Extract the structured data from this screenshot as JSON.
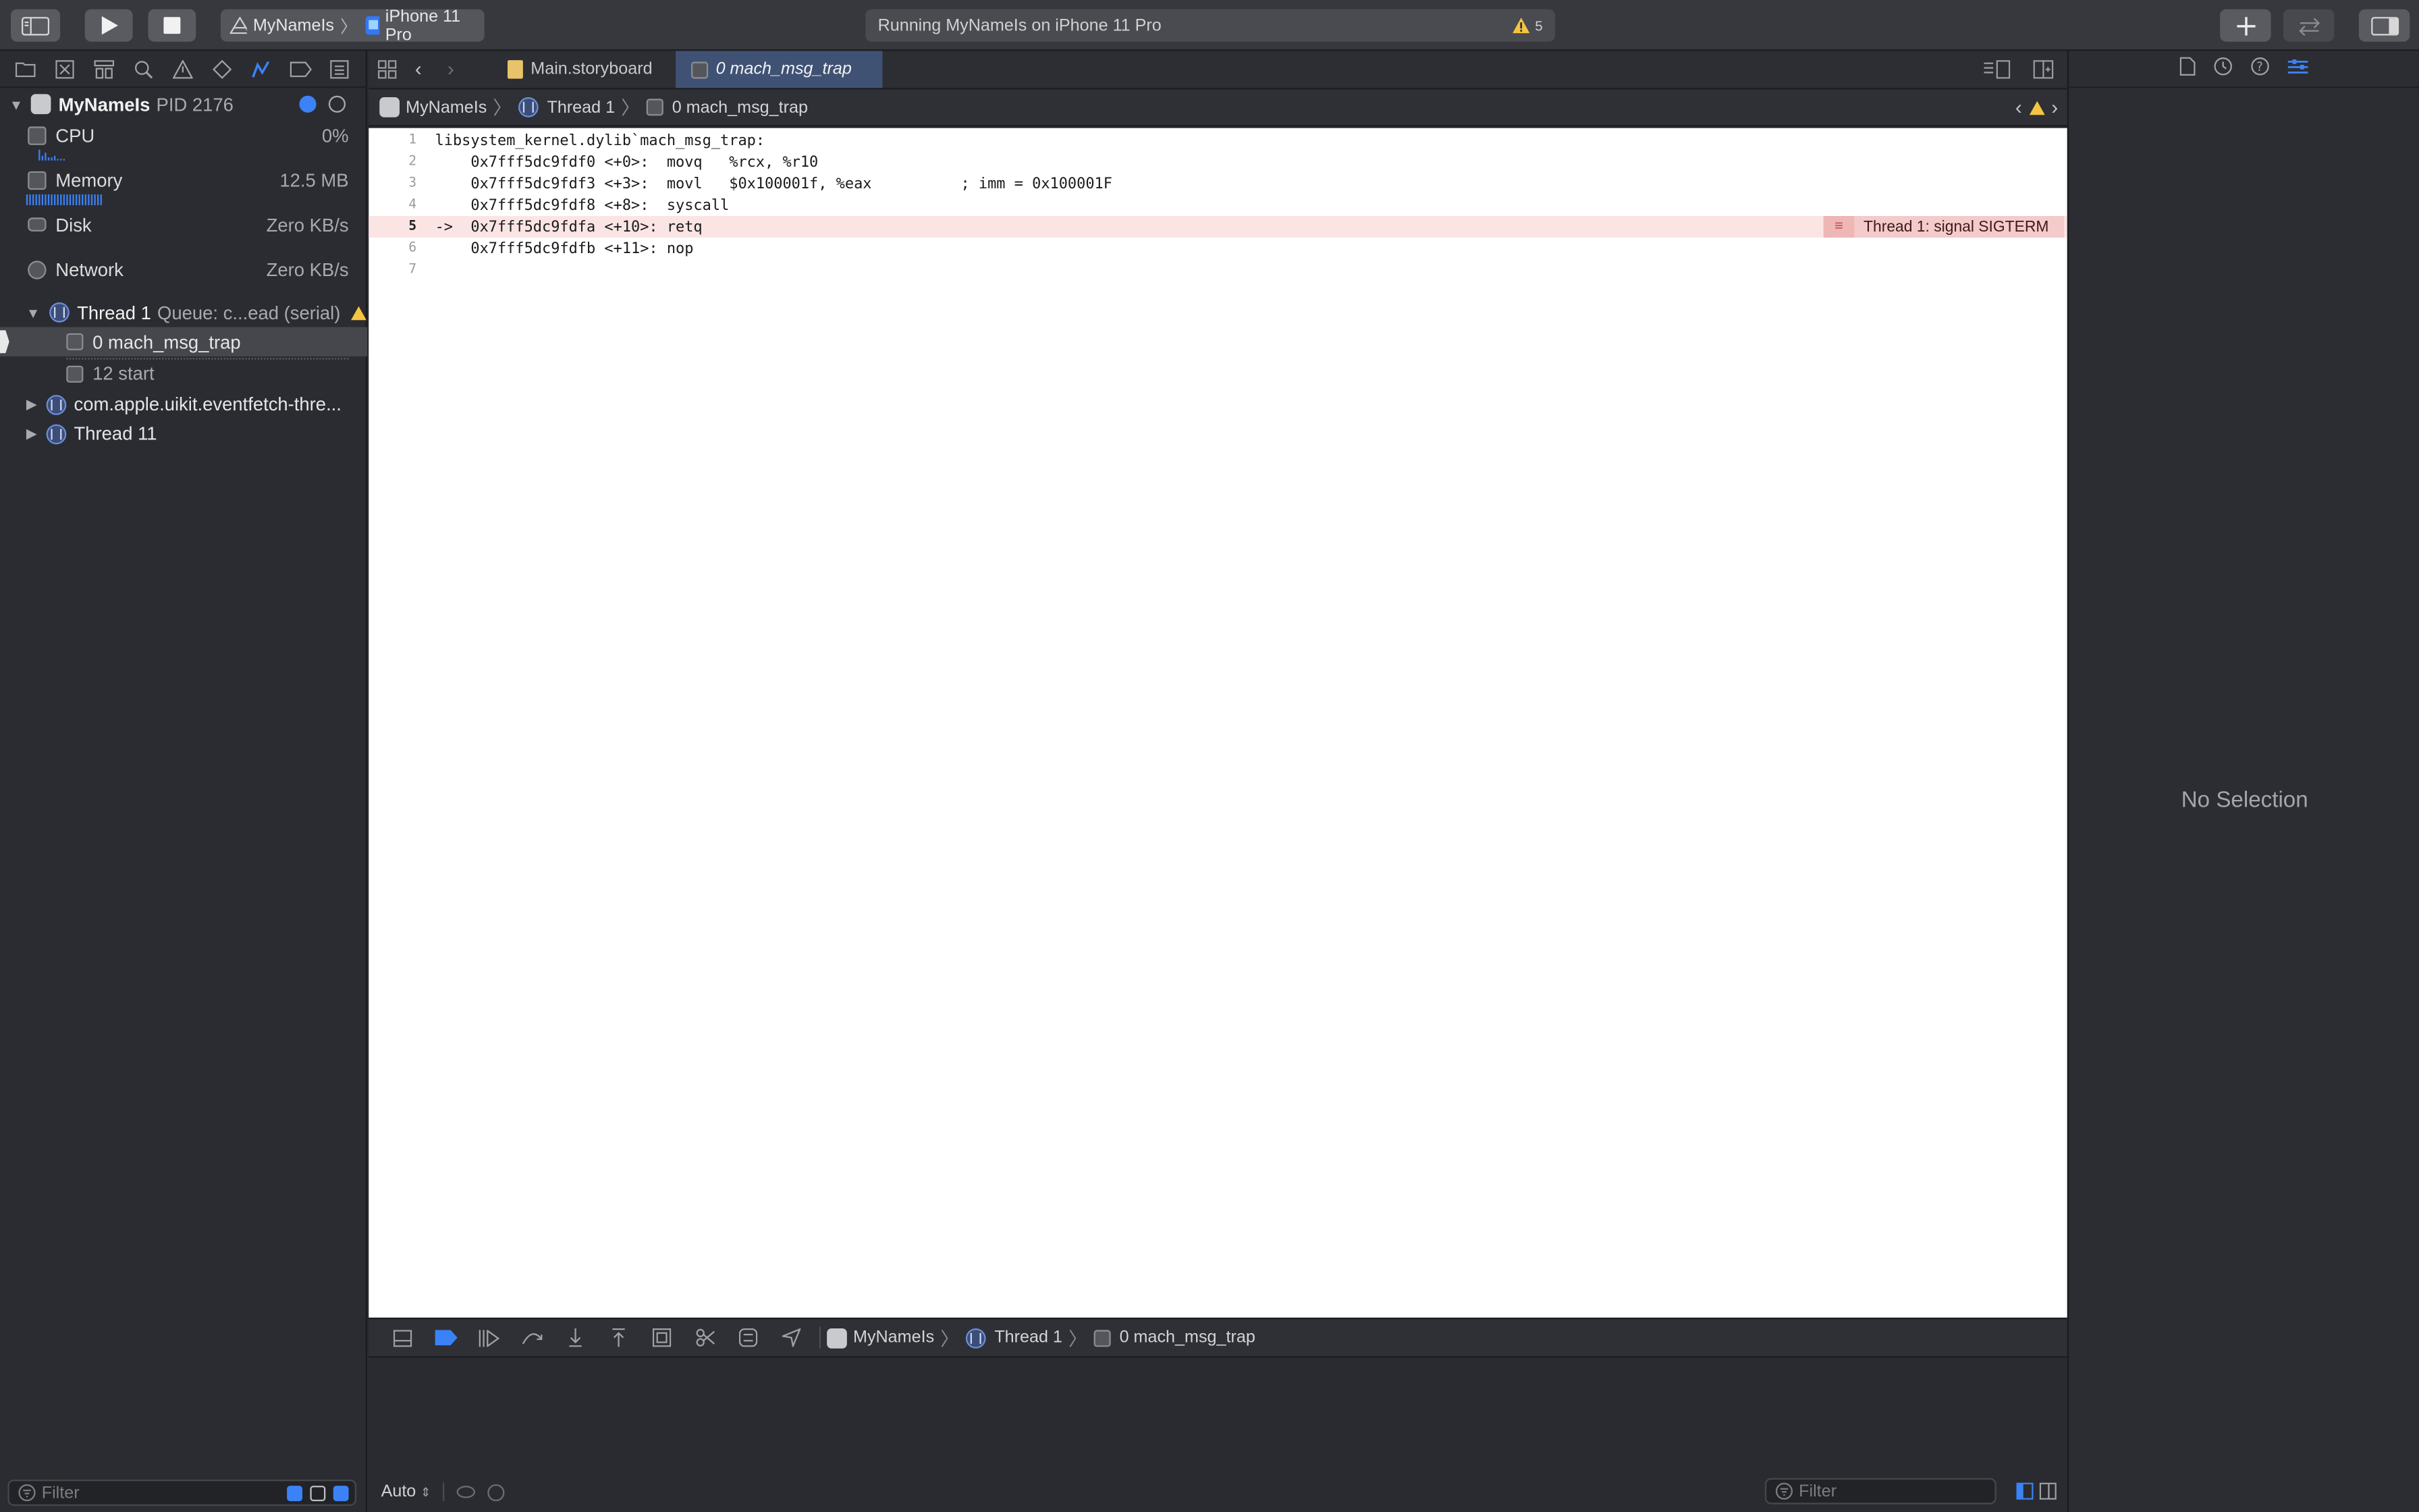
{
  "toolbar": {
    "scheme_project": "MyNameIs",
    "scheme_device": "iPhone 11 Pro",
    "activity_status": "Running MyNameIs on iPhone 11 Pro",
    "warning_count": "5"
  },
  "navigator": {
    "process_name": "MyNameIs",
    "process_pid": "PID 2176",
    "gauges": [
      {
        "label": "CPU",
        "value": "0%"
      },
      {
        "label": "Memory",
        "value": "12.5 MB"
      },
      {
        "label": "Disk",
        "value": "Zero KB/s"
      },
      {
        "label": "Network",
        "value": "Zero KB/s"
      }
    ],
    "thread1": {
      "name": "Thread 1",
      "queue": "Queue: c...ead (serial)"
    },
    "frames": [
      {
        "label": "0 mach_msg_trap"
      },
      {
        "label": "12 start"
      }
    ],
    "other_threads": [
      {
        "label": "com.apple.uikit.eventfetch-thre..."
      },
      {
        "label": "Thread 11"
      }
    ],
    "filter_placeholder": "Filter"
  },
  "editor": {
    "tabs": [
      {
        "label": "Main.storyboard"
      },
      {
        "label": "0 mach_msg_trap"
      }
    ],
    "breadcrumb": [
      "MyNameIs",
      "Thread 1",
      "0 mach_msg_trap"
    ],
    "lines": [
      {
        "num": "1",
        "text": "libsystem_kernel.dylib`mach_msg_trap:"
      },
      {
        "num": "2",
        "text": "    0x7fff5dc9fdf0 <+0>:  movq   %rcx, %r10"
      },
      {
        "num": "3",
        "text": "    0x7fff5dc9fdf3 <+3>:  movl   $0x100001f, %eax          ; imm = 0x100001F"
      },
      {
        "num": "4",
        "text": "    0x7fff5dc9fdf8 <+8>:  syscall"
      },
      {
        "num": "5",
        "text": "->  0x7fff5dc9fdfa <+10>: retq"
      },
      {
        "num": "6",
        "text": "    0x7fff5dc9fdfb <+11>: nop"
      },
      {
        "num": "7",
        "text": ""
      }
    ],
    "error_message": "Thread 1: signal SIGTERM"
  },
  "debug_bar": {
    "breadcrumb": [
      "MyNameIs",
      "Thread 1",
      "0 mach_msg_trap"
    ]
  },
  "console": {
    "mode": "Auto",
    "filter_placeholder": "Filter"
  },
  "inspector": {
    "empty_label": "No Selection"
  },
  "colors": {
    "accent": "#3b82f6",
    "error_highlight": "#fbe4e4",
    "error_badge": "#f4caca",
    "warning": "#f5c542"
  }
}
